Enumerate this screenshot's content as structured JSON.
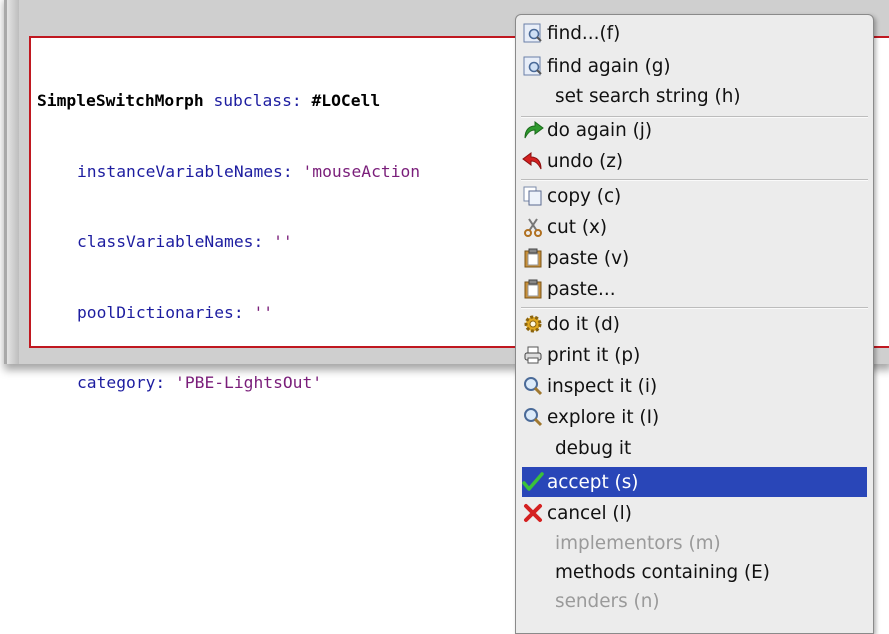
{
  "editor": {
    "line1": {
      "receiver": "SimpleSwitchMorph",
      "message": "subclass:",
      "symbol": "#LOCell"
    },
    "line2": {
      "keyword": "instanceVariableNames:",
      "value": "'mouseAction"
    },
    "line3": {
      "keyword": "classVariableNames:",
      "value": "''"
    },
    "line4": {
      "keyword": "poolDictionaries:",
      "value": "''"
    },
    "line5": {
      "keyword": "category:",
      "value": "'PBE-LightsOut'"
    }
  },
  "menu": {
    "items": [
      {
        "label": "find...(f)",
        "icon": "find-icon"
      },
      {
        "label": "find again (g)",
        "icon": "find-again-icon"
      },
      {
        "label": "set search string (h)",
        "icon": ""
      },
      {
        "label": "do again (j)",
        "icon": "redo-arrow-icon"
      },
      {
        "label": "undo (z)",
        "icon": "undo-arrow-icon"
      },
      {
        "label": "copy (c)",
        "icon": "copy-icon"
      },
      {
        "label": "cut (x)",
        "icon": "scissors-icon"
      },
      {
        "label": "paste (v)",
        "icon": "clipboard-icon"
      },
      {
        "label": "paste...",
        "icon": "clipboard-icon"
      },
      {
        "label": "do it (d)",
        "icon": "gear-icon"
      },
      {
        "label": "print it (p)",
        "icon": "printer-icon"
      },
      {
        "label": "inspect it (i)",
        "icon": "magnifier-icon"
      },
      {
        "label": "explore it (I)",
        "icon": "magnifier-icon"
      },
      {
        "label": "debug it",
        "icon": ""
      },
      {
        "label": "accept (s)",
        "icon": "checkmark-icon",
        "selected": true
      },
      {
        "label": "cancel (l)",
        "icon": "red-x-icon"
      },
      {
        "label": "implementors (m)",
        "icon": "",
        "disabled": true
      },
      {
        "label": "methods containing (E)",
        "icon": ""
      },
      {
        "label": "senders (n)",
        "icon": "",
        "disabled": true
      }
    ]
  },
  "colors": {
    "selection": "#2946b8",
    "pane_border": "#c01820",
    "disabled_text": "#9a9a9a"
  }
}
